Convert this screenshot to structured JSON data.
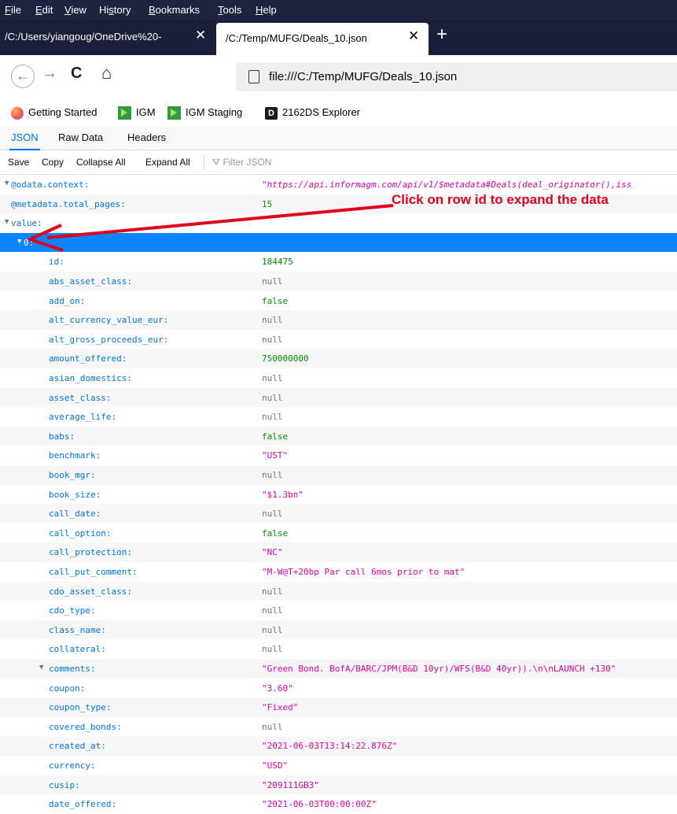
{
  "menu": [
    "File",
    "Edit",
    "View",
    "History",
    "Bookmarks",
    "Tools",
    "Help"
  ],
  "tabs": [
    {
      "title": "/C:/Users/yiangoug/OneDrive%20-",
      "close": "✕"
    },
    {
      "title": "/C:/Temp/MUFG/Deals_10.json",
      "close": "✕"
    }
  ],
  "new_tab_icon": "+",
  "nav": {
    "back": "←",
    "forward": "→",
    "reload": "C",
    "home": "⌂",
    "url": "file:///C:/Temp/MUFG/Deals_10.json"
  },
  "bookmarks": [
    {
      "label": "Getting Started",
      "icon": "firefox-icon"
    },
    {
      "label": "IGM",
      "icon": "igm-icon"
    },
    {
      "label": "IGM Staging",
      "icon": "igm-icon"
    },
    {
      "label": "2162DS Explorer",
      "icon": "d-icon"
    }
  ],
  "viewer_tabs": [
    "JSON",
    "Raw Data",
    "Headers"
  ],
  "toolbar": {
    "save": "Save",
    "copy": "Copy",
    "collapse_all": "Collapse All",
    "expand_all": "Expand All",
    "filter_placeholder": "Filter JSON"
  },
  "annotation": "Click on row id to expand the data",
  "colors": {
    "accent": "#0074e8",
    "selected_row": "#0a84ff",
    "string": "#dd00a9",
    "number": "#058b00",
    "null": "#737373",
    "annotation": "#e0001b",
    "chrome": "#202340"
  },
  "rows": [
    {
      "key": "@odata.context:",
      "value": "\"https://api.informagm.com/api/v1/$metadata#Deals(deal_originator(),iss",
      "type": "str",
      "twisty": "▼",
      "italic": true
    },
    {
      "key": "@metadata.total_pages:",
      "value": "15",
      "type": "num",
      "twisty": ""
    },
    {
      "key": "value:",
      "value": "",
      "type": "",
      "twisty": "▼"
    },
    {
      "key": "0:",
      "value": "",
      "type": "",
      "twisty": "▼"
    },
    {
      "key": "id:",
      "value": "184475",
      "type": "num",
      "twisty": ""
    },
    {
      "key": "abs_asset_class:",
      "value": "null",
      "type": "nul",
      "twisty": ""
    },
    {
      "key": "add_on:",
      "value": "false",
      "type": "bool",
      "twisty": ""
    },
    {
      "key": "alt_currency_value_eur:",
      "value": "null",
      "type": "nul",
      "twisty": ""
    },
    {
      "key": "alt_gross_proceeds_eur:",
      "value": "null",
      "type": "nul",
      "twisty": ""
    },
    {
      "key": "amount_offered:",
      "value": "750000000",
      "type": "num",
      "twisty": ""
    },
    {
      "key": "asian_domestics:",
      "value": "null",
      "type": "nul",
      "twisty": ""
    },
    {
      "key": "asset_class:",
      "value": "null",
      "type": "nul",
      "twisty": ""
    },
    {
      "key": "average_life:",
      "value": "null",
      "type": "nul",
      "twisty": ""
    },
    {
      "key": "babs:",
      "value": "false",
      "type": "bool",
      "twisty": ""
    },
    {
      "key": "benchmark:",
      "value": "\"UST\"",
      "type": "str",
      "twisty": ""
    },
    {
      "key": "book_mgr:",
      "value": "null",
      "type": "nul",
      "twisty": ""
    },
    {
      "key": "book_size:",
      "value": "\"$1.3bn\"",
      "type": "str",
      "twisty": ""
    },
    {
      "key": "call_date:",
      "value": "null",
      "type": "nul",
      "twisty": ""
    },
    {
      "key": "call_option:",
      "value": "false",
      "type": "bool",
      "twisty": ""
    },
    {
      "key": "call_protection:",
      "value": "\"NC\"",
      "type": "str",
      "twisty": ""
    },
    {
      "key": "call_put_comment:",
      "value": "\"M-W@T+20bp Par call 6mos prior to mat\"",
      "type": "str",
      "twisty": ""
    },
    {
      "key": "cdo_asset_class:",
      "value": "null",
      "type": "nul",
      "twisty": ""
    },
    {
      "key": "cdo_type:",
      "value": "null",
      "type": "nul",
      "twisty": ""
    },
    {
      "key": "class_name:",
      "value": "null",
      "type": "nul",
      "twisty": ""
    },
    {
      "key": "collateral:",
      "value": "null",
      "type": "nul",
      "twisty": ""
    },
    {
      "key": "comments:",
      "value": "\"Green Bond. BofA/BARC/JPM(B&D 10yr)/WFS(B&D 40yr)).\\n\\nLAUNCH +130\"",
      "type": "str",
      "twisty": "▼"
    },
    {
      "key": "coupon:",
      "value": "\"3.60\"",
      "type": "str",
      "twisty": ""
    },
    {
      "key": "coupon_type:",
      "value": "\"Fixed\"",
      "type": "str",
      "twisty": ""
    },
    {
      "key": "covered_bonds:",
      "value": "null",
      "type": "nul",
      "twisty": ""
    },
    {
      "key": "created_at:",
      "value": "\"2021-06-03T13:14:22.876Z\"",
      "type": "str",
      "twisty": ""
    },
    {
      "key": "currency:",
      "value": "\"USD\"",
      "type": "str",
      "twisty": ""
    },
    {
      "key": "cusip:",
      "value": "\"209111GB3\"",
      "type": "str",
      "twisty": ""
    },
    {
      "key": "date_offered:",
      "value": "\"2021-06-03T00:00:00Z\"",
      "type": "str",
      "twisty": ""
    }
  ]
}
